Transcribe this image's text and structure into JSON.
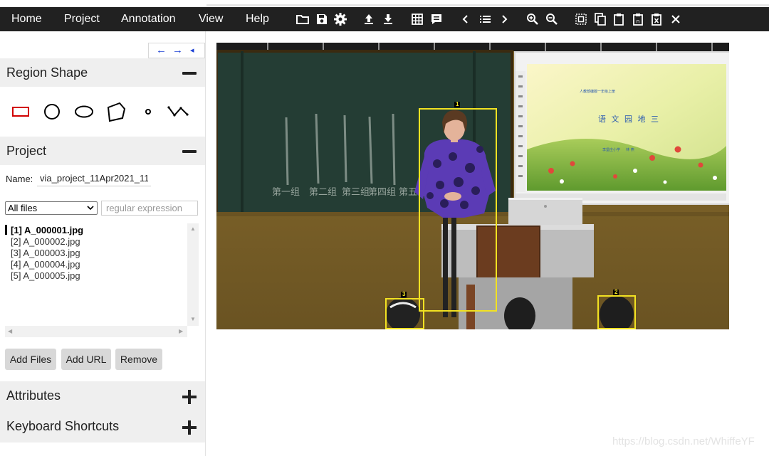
{
  "menu": {
    "items": [
      "Home",
      "Project",
      "Annotation",
      "View",
      "Help"
    ]
  },
  "toolbar": {
    "icons": [
      "folder-open-icon",
      "save-icon",
      "settings-icon",
      "upload-icon",
      "download-icon",
      "grid-view-icon",
      "comment-icon",
      "prev-image-icon",
      "list-icon",
      "next-image-icon",
      "zoom-in-icon",
      "zoom-out-icon",
      "select-all-icon",
      "copy-icon",
      "paste-icon",
      "paste-n-icon",
      "delete-icon",
      "close-icon"
    ]
  },
  "nav": {
    "left": "←",
    "right": "→",
    "collapse": "◂"
  },
  "region_shape": {
    "title": "Region Shape",
    "shapes": [
      "rectangle",
      "circle",
      "ellipse",
      "polygon",
      "point",
      "polyline"
    ]
  },
  "project": {
    "title": "Project",
    "name_label": "Name:",
    "name_value": "via_project_11Apr2021_11",
    "filter_selected": "All files",
    "regex_placeholder": "regular expression",
    "files": [
      "[1] A_000001.jpg",
      "[2] A_000002.jpg",
      "[3] A_000003.jpg",
      "[4] A_000004.jpg",
      "[5] A_000005.jpg"
    ],
    "buttons": {
      "add_files": "Add Files",
      "add_url": "Add URL",
      "remove": "Remove"
    }
  },
  "attributes": {
    "title": "Attributes"
  },
  "shortcuts": {
    "title": "Keyboard Shortcuts"
  },
  "regions": [
    {
      "id": "1",
      "label": "1"
    },
    {
      "id": "2",
      "label": "2"
    },
    {
      "id": "3",
      "label": "3"
    }
  ],
  "slide": {
    "title": "语 文 园 地 三",
    "subtitle": "人教部编版一年级上册",
    "author": "李堡庄小学 　 林 燕"
  },
  "board": {
    "groups": [
      "第一组",
      "第二组",
      "第三组",
      "第四组",
      "第五组"
    ]
  },
  "colors": {
    "region": "#f2e222",
    "menubar": "#212121",
    "rect_shape": "#d10000"
  },
  "watermark": "https://blog.csdn.net/WhiffeYF"
}
